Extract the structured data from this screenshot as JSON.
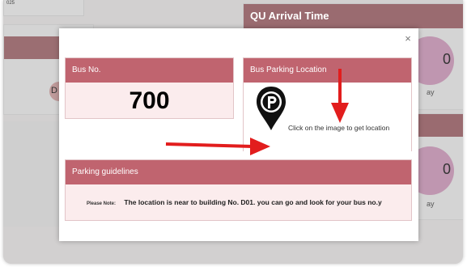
{
  "background": {
    "corner_text": "025",
    "left_badge_text": "D",
    "arrival_card_title": "QU Arrival Time",
    "count_1": "0",
    "day_1": "ay",
    "count_2": "0",
    "day_2": "ay"
  },
  "modal": {
    "close_glyph": "×",
    "bus_card": {
      "title": "Bus No.",
      "number": "700"
    },
    "location_card": {
      "title": "Bus Parking Location",
      "icon": "parking-pin-icon",
      "hint": "Click on the image to get location"
    },
    "guidelines_card": {
      "title": "Parking guidelines",
      "note_label": "Please Note:",
      "note_text": "The location is near to building No. D01. you can go and look for your bus no.y"
    }
  },
  "colors": {
    "header": "#c0646f",
    "card_bg": "#fbeced",
    "arrow": "#e21d1d"
  }
}
